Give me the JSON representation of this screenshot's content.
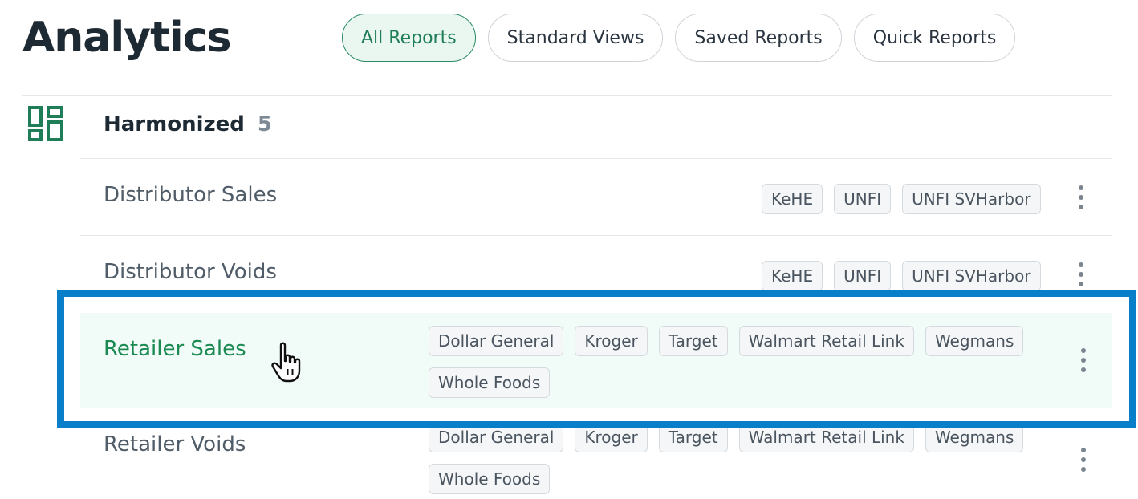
{
  "page": {
    "title": "Analytics"
  },
  "tabs": [
    {
      "label": "All Reports",
      "active": true
    },
    {
      "label": "Standard Views",
      "active": false
    },
    {
      "label": "Saved Reports",
      "active": false
    },
    {
      "label": "Quick Reports",
      "active": false
    }
  ],
  "group": {
    "title": "Harmonized",
    "count": "5",
    "icon": "dashboard-grid-icon"
  },
  "reports": [
    {
      "name": "Distributor Sales",
      "tags": [
        "KeHE",
        "UNFI",
        "UNFI SVHarbor"
      ]
    },
    {
      "name": "Distributor Voids",
      "tags": [
        "KeHE",
        "UNFI",
        "UNFI SVHarbor"
      ]
    },
    {
      "name": "Retailer Sales",
      "tags": [
        "Dollar General",
        "Kroger",
        "Target",
        "Walmart Retail Link",
        "Wegmans",
        "Whole Foods"
      ],
      "highlighted": true
    },
    {
      "name": "Retailer Voids",
      "tags": [
        "Dollar General",
        "Kroger",
        "Target",
        "Walmart Retail Link",
        "Wegmans",
        "Whole Foods"
      ]
    }
  ],
  "colors": {
    "accent": "#1f7d58",
    "highlight_bg": "#f1fbf7",
    "selection_border": "#0a7fc9"
  }
}
